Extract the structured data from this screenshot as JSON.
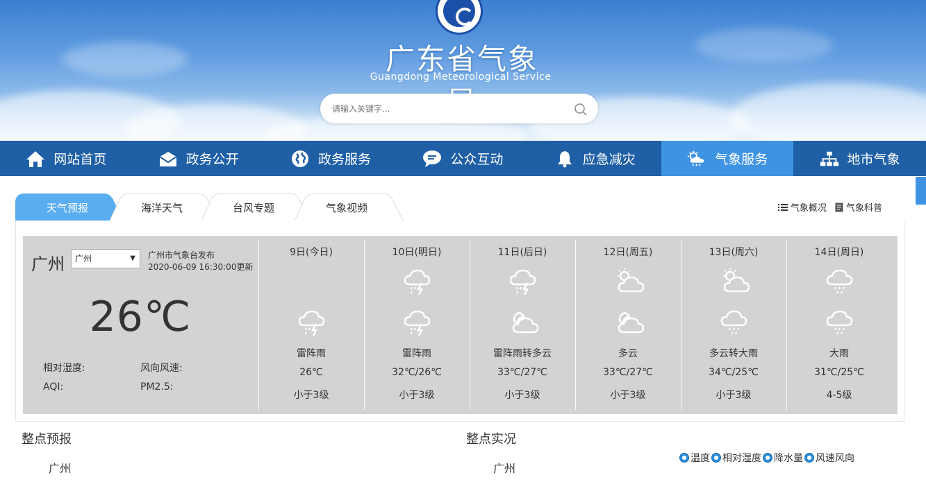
{
  "header": {
    "title": "广东省气象局",
    "subtitle": "Guangdong Meteorological Service",
    "search_placeholder": "请输入关键字..."
  },
  "nav": [
    {
      "label": "网站首页",
      "icon": "home-icon"
    },
    {
      "label": "政务公开",
      "icon": "envelope-icon"
    },
    {
      "label": "政务服务",
      "icon": "globe-icon"
    },
    {
      "label": "公众互动",
      "icon": "chat-icon"
    },
    {
      "label": "应急减灾",
      "icon": "bell-icon"
    },
    {
      "label": "气象服务",
      "icon": "weather-icon",
      "active": true
    },
    {
      "label": "地市气象",
      "icon": "sitemap-icon"
    }
  ],
  "tabs": [
    "天气预报",
    "海洋天气",
    "台风专题",
    "气象视频"
  ],
  "right_links": [
    {
      "label": "气象概况",
      "icon": "list-icon"
    },
    {
      "label": "气象科普",
      "icon": "document-icon"
    }
  ],
  "current": {
    "city": "广州",
    "selected_city": "广州",
    "publisher": "广州市气象台发布",
    "updated": "2020-06-09 16:30:00更新",
    "temperature": "26℃",
    "humidity_label": "相对湿度:",
    "wind_label": "风向风速:",
    "aqi_label": "AQI:",
    "pm25_label": "PM2.5:"
  },
  "days": [
    {
      "date": "9日(今日)",
      "icon_day": "",
      "icon_night": "thunderstorm-icon",
      "desc": "雷阵雨",
      "temp": "26℃",
      "wind": "小于3级"
    },
    {
      "date": "10日(明日)",
      "icon_day": "thunderstorm-icon",
      "icon_night": "thunderstorm-icon",
      "desc": "雷阵雨",
      "temp": "32℃/26℃",
      "wind": "小于3级"
    },
    {
      "date": "11日(后日)",
      "icon_day": "thunderstorm-icon",
      "icon_night": "cloudy-night-icon",
      "desc": "雷阵雨转多云",
      "temp": "33℃/27℃",
      "wind": "小于3级"
    },
    {
      "date": "12日(周五)",
      "icon_day": "partly-cloudy-day-icon",
      "icon_night": "cloudy-night-icon",
      "desc": "多云",
      "temp": "33℃/27℃",
      "wind": "小于3级"
    },
    {
      "date": "13日(周六)",
      "icon_day": "partly-cloudy-day-icon",
      "icon_night": "rain-icon",
      "desc": "多云转大雨",
      "temp": "34℃/25℃",
      "wind": "小于3级"
    },
    {
      "date": "14日(周日)",
      "icon_day": "rain-icon",
      "icon_night": "rain-icon",
      "desc": "大雨",
      "temp": "31℃/25℃",
      "wind": "4-5级"
    }
  ],
  "hourly_forecast": {
    "title": "整点预报",
    "city": "广州"
  },
  "hourly_observed": {
    "title": "整点实况",
    "city": "广州"
  },
  "legend": [
    "温度",
    "相对湿度",
    "降水量",
    "风速风向"
  ]
}
